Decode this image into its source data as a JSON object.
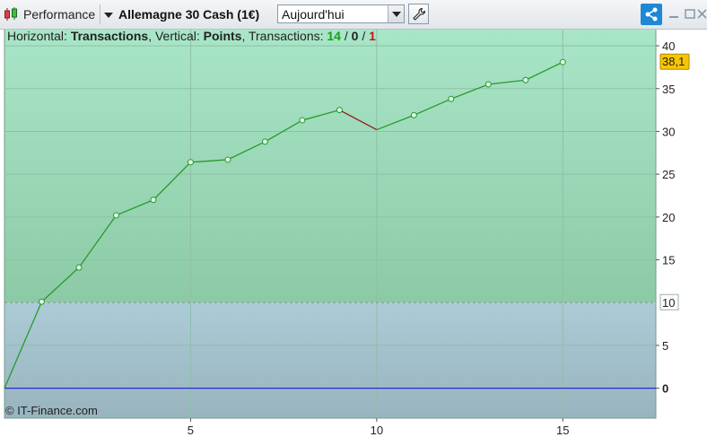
{
  "toolbar": {
    "performance_label": "Performance",
    "instrument_label": "Allemagne 30 Cash (1€)",
    "period_value": "Aujourd'hui"
  },
  "info": {
    "horizontal_label": "Horizontal:",
    "horizontal_value": "Transactions",
    "vertical_label": ", Vertical:",
    "vertical_value": "Points",
    "transactions_label": ", Transactions:",
    "wins": "14",
    "sep1": " / ",
    "neutral": "0",
    "sep2": " / ",
    "losses": "1"
  },
  "copyright": "© IT-Finance.com",
  "colors": {
    "gain_line": "#2a9a2a",
    "loss_line": "#9a1a1a",
    "zero_line": "#2b2bd0",
    "last_value_badge": "#f7c600",
    "threshold_badge_text": "#2a9a2a"
  },
  "chart_data": {
    "type": "line",
    "x": [
      0,
      1,
      2,
      3,
      4,
      5,
      6,
      7,
      8,
      9,
      10,
      11,
      12,
      13,
      14,
      15
    ],
    "values": [
      0,
      10.1,
      14.1,
      20.2,
      22.0,
      26.4,
      26.7,
      28.8,
      31.3,
      32.5,
      30.2,
      31.9,
      33.8,
      35.5,
      36.0,
      38.1
    ],
    "loss_segments": [
      [
        9,
        10
      ]
    ],
    "xlim": [
      0,
      17.5
    ],
    "ylim": [
      -3.5,
      42
    ],
    "x_ticks": [
      "5",
      "10",
      "15"
    ],
    "x_tick_values": [
      5,
      10,
      15
    ],
    "y_ticks": [
      "0",
      "5",
      "10",
      "15",
      "20",
      "25",
      "30",
      "35",
      "40"
    ],
    "y_tick_values": [
      0,
      5,
      10,
      15,
      20,
      25,
      30,
      35,
      40
    ],
    "threshold": 10,
    "threshold_label": "10",
    "last_value_label": "38,1",
    "grid": true
  }
}
